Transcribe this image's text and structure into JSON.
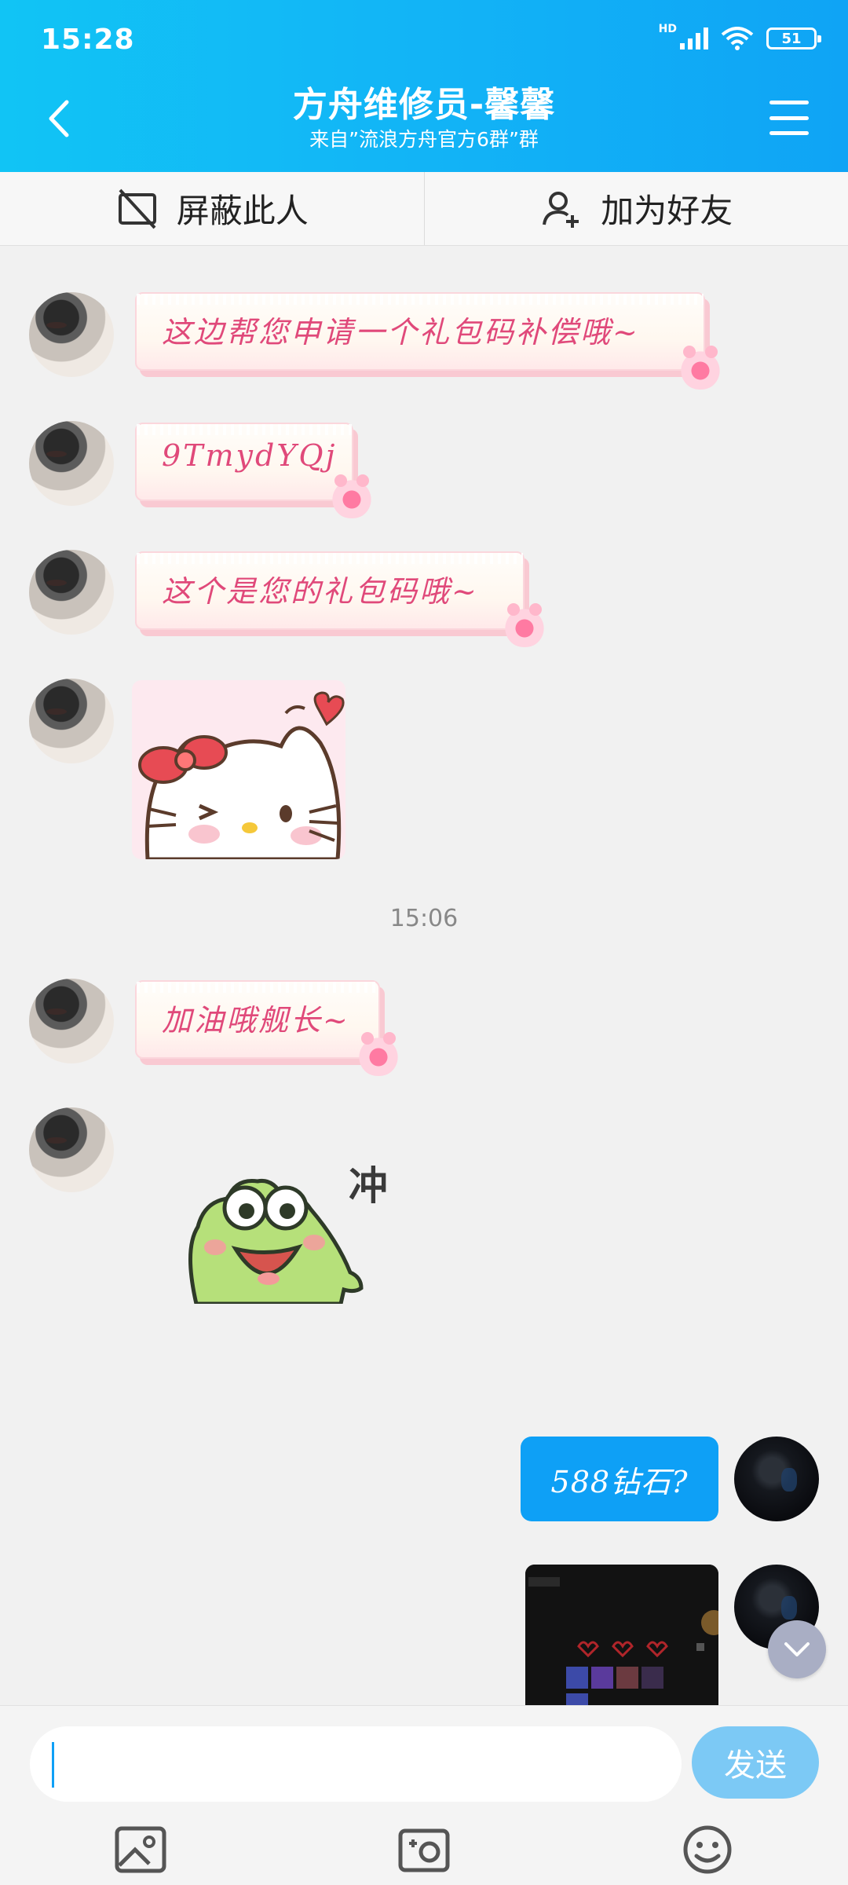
{
  "status_bar": {
    "time": "15:28",
    "network": "HD",
    "battery": "51"
  },
  "header": {
    "title": "方舟维修员-馨馨",
    "subtitle": "来自”流浪方舟官方6群”群"
  },
  "actions": {
    "block_label": "屏蔽此人",
    "add_friend_label": "加为好友"
  },
  "messages": [
    {
      "from": "other",
      "type": "text",
      "text": "这边帮您申请一个礼包码补偿哦~"
    },
    {
      "from": "other",
      "type": "text",
      "text": "9TmydYQj"
    },
    {
      "from": "other",
      "type": "text",
      "text": "这个是您的礼包码哦~"
    },
    {
      "from": "other",
      "type": "sticker",
      "sticker": "hello-kitty-heart"
    },
    {
      "from": "other",
      "type": "text",
      "text": "加油哦舰长~"
    },
    {
      "from": "other",
      "type": "sticker",
      "sticker": "frog",
      "caption": "冲"
    },
    {
      "from": "me",
      "type": "text",
      "text": "588钻石?"
    },
    {
      "from": "me",
      "type": "image",
      "image": "game-screenshot"
    }
  ],
  "time_divider": "15:06",
  "input": {
    "placeholder": "",
    "value": "",
    "send_label": "发送"
  },
  "toolbar": [
    "image-icon",
    "camera-icon",
    "emoji-icon"
  ],
  "colors": {
    "header": "#11b8f5",
    "accent": "#0ea0f6",
    "send": "#7cc9f5",
    "bubble_text": "#e0497a"
  }
}
